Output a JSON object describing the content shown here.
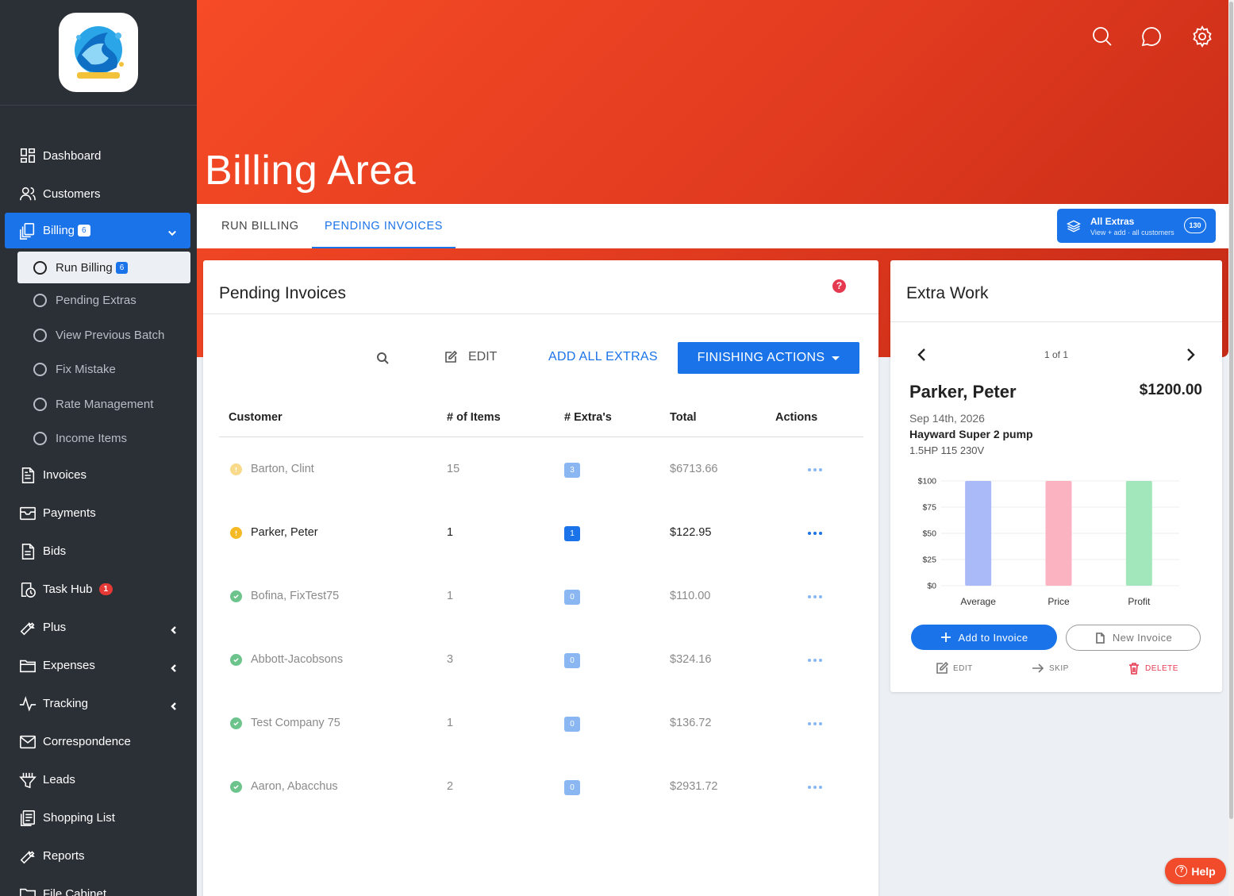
{
  "sidebar": {
    "logo_icon": "splash-logo-icon",
    "items": [
      {
        "label": "Dashboard",
        "icon": "dashboard-icon"
      },
      {
        "label": "Customers",
        "icon": "users-icon"
      },
      {
        "label": "Billing",
        "icon": "billing-icon",
        "badge": "6",
        "active": true
      },
      {
        "label": "Invoices",
        "icon": "document-icon"
      },
      {
        "label": "Payments",
        "icon": "payments-icon"
      },
      {
        "label": "Bids",
        "icon": "bids-icon"
      },
      {
        "label": "Task Hub",
        "icon": "clock-icon",
        "badge": "1"
      },
      {
        "label": "Plus",
        "icon": "wrench-icon"
      },
      {
        "label": "Expenses",
        "icon": "folder-icon"
      },
      {
        "label": "Tracking",
        "icon": "pulse-icon"
      },
      {
        "label": "Correspondence",
        "icon": "mail-icon"
      },
      {
        "label": "Leads",
        "icon": "funnel-icon"
      },
      {
        "label": "Shopping List",
        "icon": "list-icon"
      },
      {
        "label": "Reports",
        "icon": "wrench-icon"
      },
      {
        "label": "File Cabinet",
        "icon": "folder-icon"
      }
    ],
    "billing_sub": [
      {
        "label": "Run Billing",
        "badge": "6",
        "active": true
      },
      {
        "label": "Pending Extras"
      },
      {
        "label": "View Previous Batch"
      },
      {
        "label": "Fix Mistake"
      },
      {
        "label": "Rate Management"
      },
      {
        "label": "Income Items"
      }
    ]
  },
  "header": {
    "title": "Billing Area",
    "icons": [
      "search-icon",
      "chat-icon",
      "gear-icon"
    ]
  },
  "tabs": [
    {
      "label": "RUN BILLING"
    },
    {
      "label": "PENDING INVOICES",
      "active": true
    }
  ],
  "all_extras": {
    "title": "All Extras",
    "subtitle": "View + add · all customers",
    "count": "130"
  },
  "pending": {
    "title": "Pending Invoices",
    "help": "?",
    "edit_label": "EDIT",
    "add_all_label": "ADD ALL EXTRAS",
    "finishing_label": "FINISHING ACTIONS",
    "columns": [
      "Customer",
      "# of Items",
      "# Extra's",
      "Total",
      "Actions"
    ],
    "rows": [
      {
        "customer": "Barton, Clint",
        "items": "15",
        "extras": "3",
        "total": "$6713.66",
        "status": "warning"
      },
      {
        "customer": "Parker, Peter",
        "items": "1",
        "extras": "1",
        "total": "$122.95",
        "status": "warning"
      },
      {
        "customer": "Bofina, FixTest75",
        "items": "1",
        "extras": "0",
        "total": "$110.00",
        "status": "ok"
      },
      {
        "customer": "Abbott-Jacobsons",
        "items": "3",
        "extras": "0",
        "total": "$324.16",
        "status": "ok"
      },
      {
        "customer": "Test Company 75",
        "items": "1",
        "extras": "0",
        "total": "$136.72",
        "status": "ok"
      },
      {
        "customer": "Aaron, Abacchus",
        "items": "2",
        "extras": "0",
        "total": "$2931.72",
        "status": "ok"
      }
    ]
  },
  "extra_work": {
    "title": "Extra Work",
    "pager": "1 of 1",
    "customer": "Parker, Peter",
    "amount": "$1200.00",
    "date": "Sep 14th, 2026",
    "item": "Hayward Super 2 pump",
    "desc": "1.5HP 115 230V",
    "add_label": "Add to Invoice",
    "new_label": "New Invoice",
    "edit_label": "EDIT",
    "skip_label": "SKIP",
    "delete_label": "DELETE"
  },
  "chart_data": {
    "type": "bar",
    "categories": [
      "Average",
      "Price",
      "Profit"
    ],
    "values": [
      100,
      100,
      100
    ],
    "colors": [
      "#aab9f7",
      "#fbb2c1",
      "#a2e6bb"
    ],
    "yticks": [
      "$0",
      "$25",
      "$50",
      "$75",
      "$100"
    ],
    "ylim": [
      0,
      100
    ]
  },
  "help_fab": {
    "label": "Help"
  }
}
